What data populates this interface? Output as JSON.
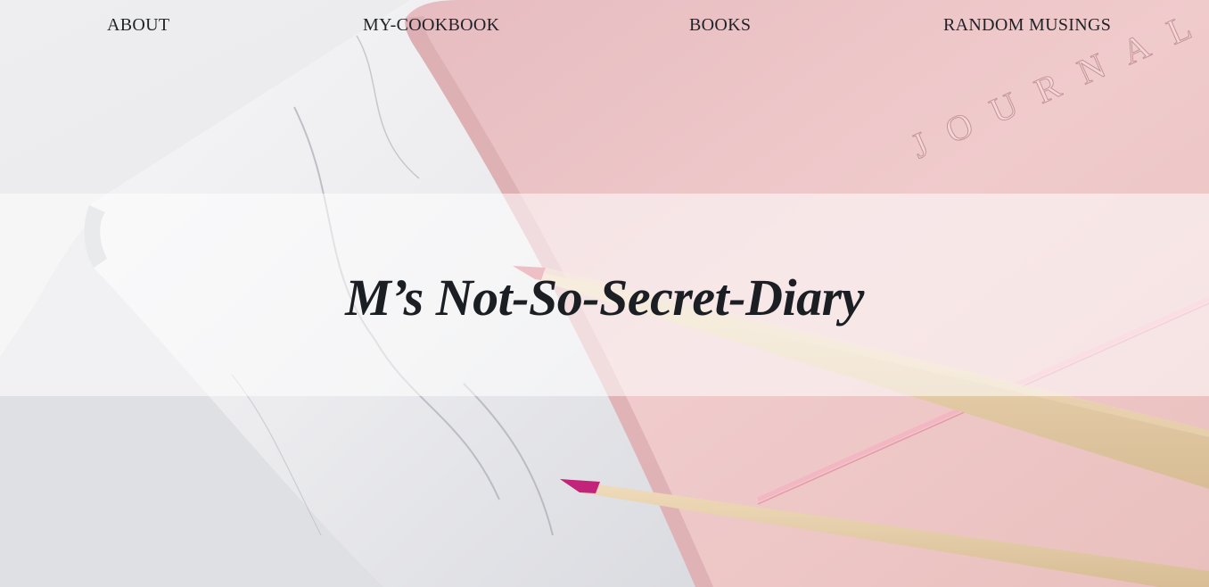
{
  "nav": {
    "about": "ABOUT",
    "cookbook": "MY-COOKBOOK",
    "books": "BOOKS",
    "musings": "RANDOM MUSINGS"
  },
  "hero": {
    "title": "M’s Not-So-Secret-Diary",
    "journal_emboss": "JOURNAL"
  },
  "colors": {
    "text": "#1b1f24",
    "journal_pink": "#efc7c8",
    "marble": "#f2f2f4",
    "pencil_wood": "#e8d2b0",
    "pencil_tip_1": "#d9737f",
    "pencil_tip_2": "#c2247a"
  }
}
